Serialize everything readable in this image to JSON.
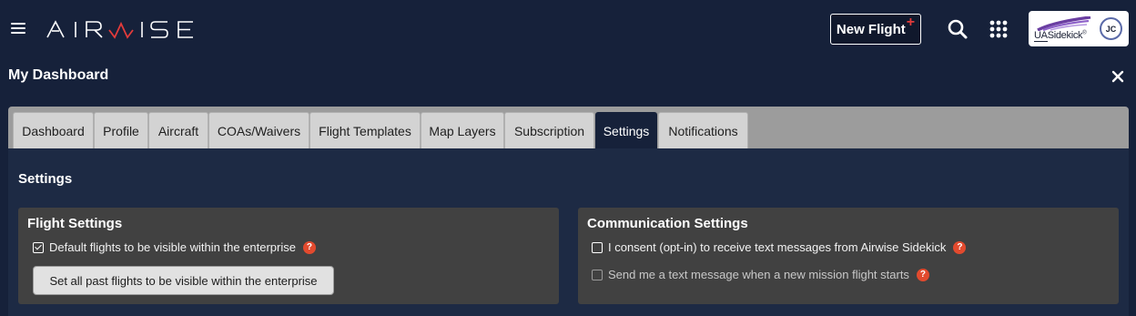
{
  "header": {
    "logo_text": "AIRWISE",
    "new_flight_label": "New Flight",
    "new_flight_plus": "+",
    "sidekick_ua": "UA",
    "sidekick_name": "Sidekick",
    "sidekick_mark": "®",
    "avatar_initials": "JC",
    "icons": {
      "menu": "hamburger-menu-icon",
      "search": "search-icon",
      "apps": "apps-grid-icon",
      "close": "close-icon"
    },
    "accent_color": "#e23b3b"
  },
  "dashboard": {
    "title": "My Dashboard",
    "tabs": [
      {
        "label": "Dashboard",
        "active": false
      },
      {
        "label": "Profile",
        "active": false
      },
      {
        "label": "Aircraft",
        "active": false
      },
      {
        "label": "COAs/Waivers",
        "active": false
      },
      {
        "label": "Flight Templates",
        "active": false
      },
      {
        "label": "Map Layers",
        "active": false
      },
      {
        "label": "Subscription",
        "active": false
      },
      {
        "label": "Settings",
        "active": true
      },
      {
        "label": "Notifications",
        "active": false
      }
    ]
  },
  "settings": {
    "title": "Settings",
    "flight_settings": {
      "title": "Flight Settings",
      "default_visibility_label": "Default flights to be visible within the enterprise",
      "default_visibility_checked": true,
      "bulk_button_label": "Set all past flights to be visible within the enterprise"
    },
    "communication_settings": {
      "title": "Communication Settings",
      "sms_consent_label": "I consent (opt-in) to receive text messages from Airwise Sidekick",
      "sms_consent_checked": false,
      "mission_sms_label": "Send me a text message when a new mission flight starts",
      "mission_sms_checked": false
    },
    "help_glyph": "?"
  }
}
